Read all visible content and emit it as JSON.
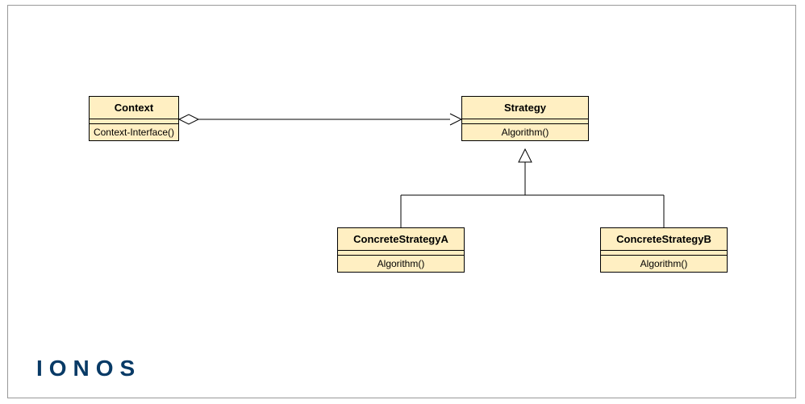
{
  "classes": {
    "context": {
      "title": "Context",
      "op": "Context-Interface()"
    },
    "strategy": {
      "title": "Strategy",
      "op": "Algorithm()"
    },
    "concreteA": {
      "title": "ConcreteStrategyA",
      "op": "Algorithm()"
    },
    "concreteB": {
      "title": "ConcreteStrategyB",
      "op": "Algorithm()"
    }
  },
  "brand": "IONOS",
  "diagram": {
    "pattern": "Strategy",
    "relations": [
      {
        "from": "Context",
        "to": "Strategy",
        "type": "aggregation-dependency"
      },
      {
        "from": "ConcreteStrategyA",
        "to": "Strategy",
        "type": "generalization"
      },
      {
        "from": "ConcreteStrategyB",
        "to": "Strategy",
        "type": "generalization"
      }
    ]
  }
}
